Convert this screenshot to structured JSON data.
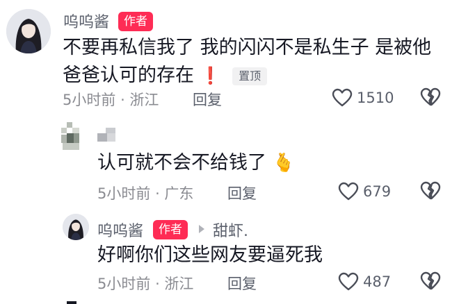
{
  "comments": [
    {
      "author": "呜呜酱",
      "badge": "作者",
      "text_line1": "不要再私信我了 我的闪闪不是私生子 是被他",
      "text_line2": "爸爸认可的存在",
      "exclamation": "❗",
      "pin_label": "置顶",
      "time": "5小时前",
      "location": "浙江",
      "reply_label": "回复",
      "likes": "1510"
    },
    {
      "author": "",
      "text": "认可就不会不给钱了",
      "emoji": "🫰",
      "time": "5小时前",
      "location": "广东",
      "reply_label": "回复",
      "likes": "679"
    },
    {
      "author": "呜呜酱",
      "badge": "作者",
      "reply_to": "甜虾.",
      "text": "好啊你们这些网友要逼死我",
      "time": "5小时前",
      "location": "浙江",
      "reply_label": "回复",
      "likes": "487"
    }
  ],
  "colors": {
    "badge": "#fe2c55",
    "meta": "#8a8b91",
    "text": "#161823"
  },
  "icons": [
    "heart-outline-icon",
    "dislike-broken-heart-icon",
    "reply-arrow-icon"
  ]
}
